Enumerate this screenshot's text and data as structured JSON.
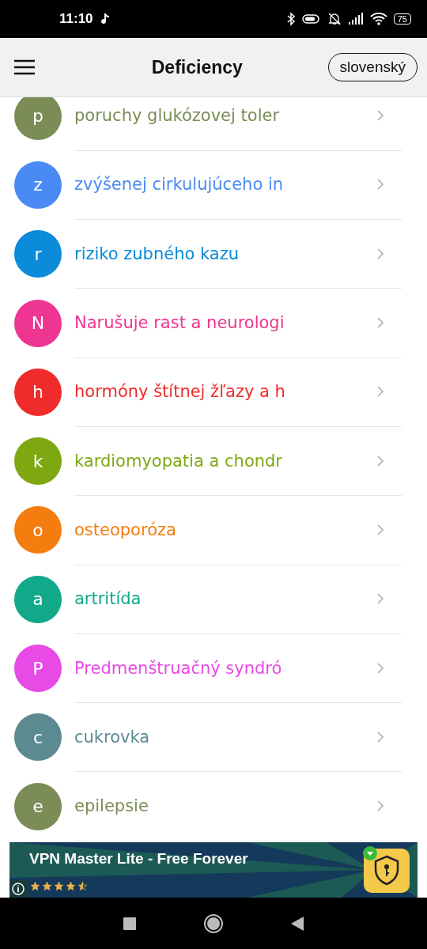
{
  "status_bar": {
    "time": "11:10",
    "battery": "75"
  },
  "header": {
    "title": "Deficiency",
    "language": "slovenský"
  },
  "items": [
    {
      "letter": "p",
      "label": "poruchy glukózovej toler",
      "color": "#7b8c56"
    },
    {
      "letter": "z",
      "label": "zvýšenej cirkulujúceho in",
      "color": "#4a8af4"
    },
    {
      "letter": "r",
      "label": "riziko zubného kazu",
      "color": "#0b8bd9"
    },
    {
      "letter": "N",
      "label": "Narušuje rast a neurologi",
      "color": "#ee3591"
    },
    {
      "letter": "h",
      "label": "hormóny štítnej žľazy a h",
      "color": "#f02b2b"
    },
    {
      "letter": "k",
      "label": "kardiomyopatia a chondr",
      "color": "#7ea812"
    },
    {
      "letter": "o",
      "label": "osteoporóza",
      "color": "#f57d0f"
    },
    {
      "letter": "a",
      "label": "artritída",
      "color": "#12a88a"
    },
    {
      "letter": "P",
      "label": "Predmenštruačný syndró",
      "color": "#e84ae6"
    },
    {
      "letter": "c",
      "label": "cukrovka",
      "color": "#5b8a91"
    },
    {
      "letter": "e",
      "label": "epilepsie",
      "color": "#7b8c56"
    }
  ],
  "ad": {
    "title": "VPN Master Lite - Free Forever",
    "stars": 4.5
  }
}
